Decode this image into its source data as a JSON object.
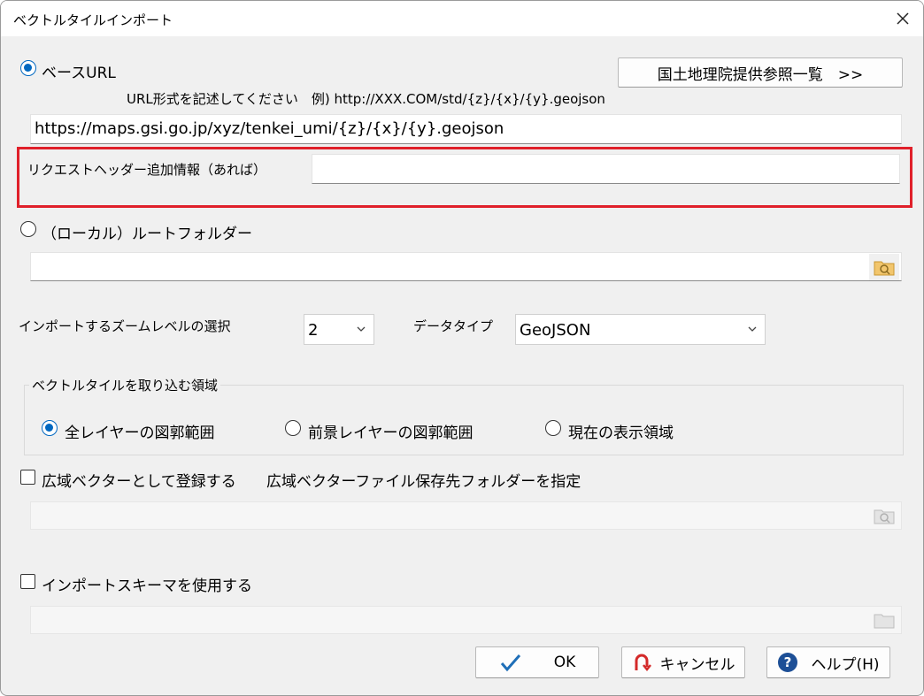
{
  "window": {
    "title": "ベクトルタイルインポート"
  },
  "source": {
    "base_url_label": "ベースURL",
    "url_hint": "URL形式を記述してください　例) http://XXX.COM/std/{z}/{x}/{y}.geojson",
    "gsi_list_button": "国土地理院提供参照一覧　>>",
    "url_value": "https://maps.gsi.go.jp/xyz/tenkei_umi/{z}/{x}/{y}.geojson",
    "header_label": "リクエストヘッダー追加情報（あれば）",
    "header_value": "",
    "local_label": "（ローカル）ルートフォルダー",
    "local_value": ""
  },
  "zoom": {
    "label": "インポートするズームレベルの選択",
    "value": "2",
    "datatype_label": "データタイプ",
    "datatype_value": "GeoJSON"
  },
  "area": {
    "group_label": "ベクトルタイルを取り込む領域",
    "options": [
      "全レイヤーの図郭範囲",
      "前景レイヤーの図郭範囲",
      "現在の表示領域"
    ],
    "selected": "全レイヤーの図郭範囲"
  },
  "wide_vector": {
    "checkbox_label": "広域ベクターとして登録する",
    "folder_label": "広域ベクターファイル保存先フォルダーを指定",
    "checked": false
  },
  "schema": {
    "checkbox_label": "インポートスキーマを使用する",
    "checked": false
  },
  "buttons": {
    "ok": "OK",
    "cancel": "キャンセル",
    "help": "ヘルプ(H)"
  },
  "colors": {
    "accent": "#0067c0",
    "highlight": "#e0202a"
  }
}
